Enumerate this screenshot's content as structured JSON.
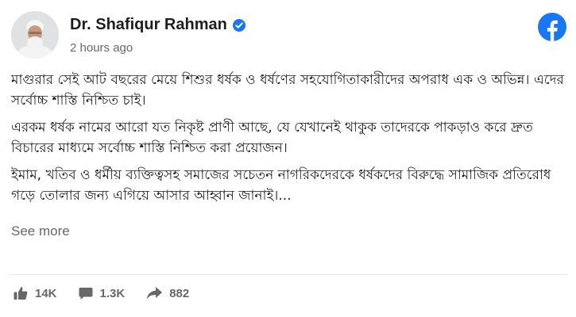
{
  "post": {
    "author": "Dr. Shafiqur Rahman",
    "timestamp": "2 hours ago",
    "paragraphs": [
      "মাগুরার সেই আট বছরের মেয়ে শিশুর ধর্ষক ও ধর্ষণের সহযোগিতাকারীদের অপরাধ এক ও অভিন্ন। এদের সর্বোচ্চ শাস্তি নিশ্চিত চাই।",
      "এরকম ধর্ষক নামের আরো যত নিকৃষ্ট প্রাণী আছে, যে যেখানেই থাকুক তাদেরকে পাকড়াও করে দ্রুত বিচারের মাধ্যমে সর্বোচ্চ শাস্তি নিশ্চিত করা প্রয়োজন।",
      "ইমাম, খতিব ও ধর্মীয় ব্যক্তিত্বসহ সমাজের সচেতন নাগরিকদেরকে ধর্ষকদের বিরুদ্ধে সামাজিক প্রতিরোধ গড়ে তোলার জন্য এগিয়ে আসার আহ্বান জানাই।..."
    ],
    "see_more": "See more"
  },
  "stats": {
    "likes": "14K",
    "comments": "1.3K",
    "shares": "882"
  },
  "icons": {
    "verified": "verified-badge-icon",
    "brand": "facebook-logo-icon",
    "like": "thumbs-up-icon",
    "comment": "comment-bubble-icon",
    "share": "share-arrow-icon"
  },
  "colors": {
    "facebook_blue": "#1877f2",
    "secondary_text": "#65676b"
  }
}
